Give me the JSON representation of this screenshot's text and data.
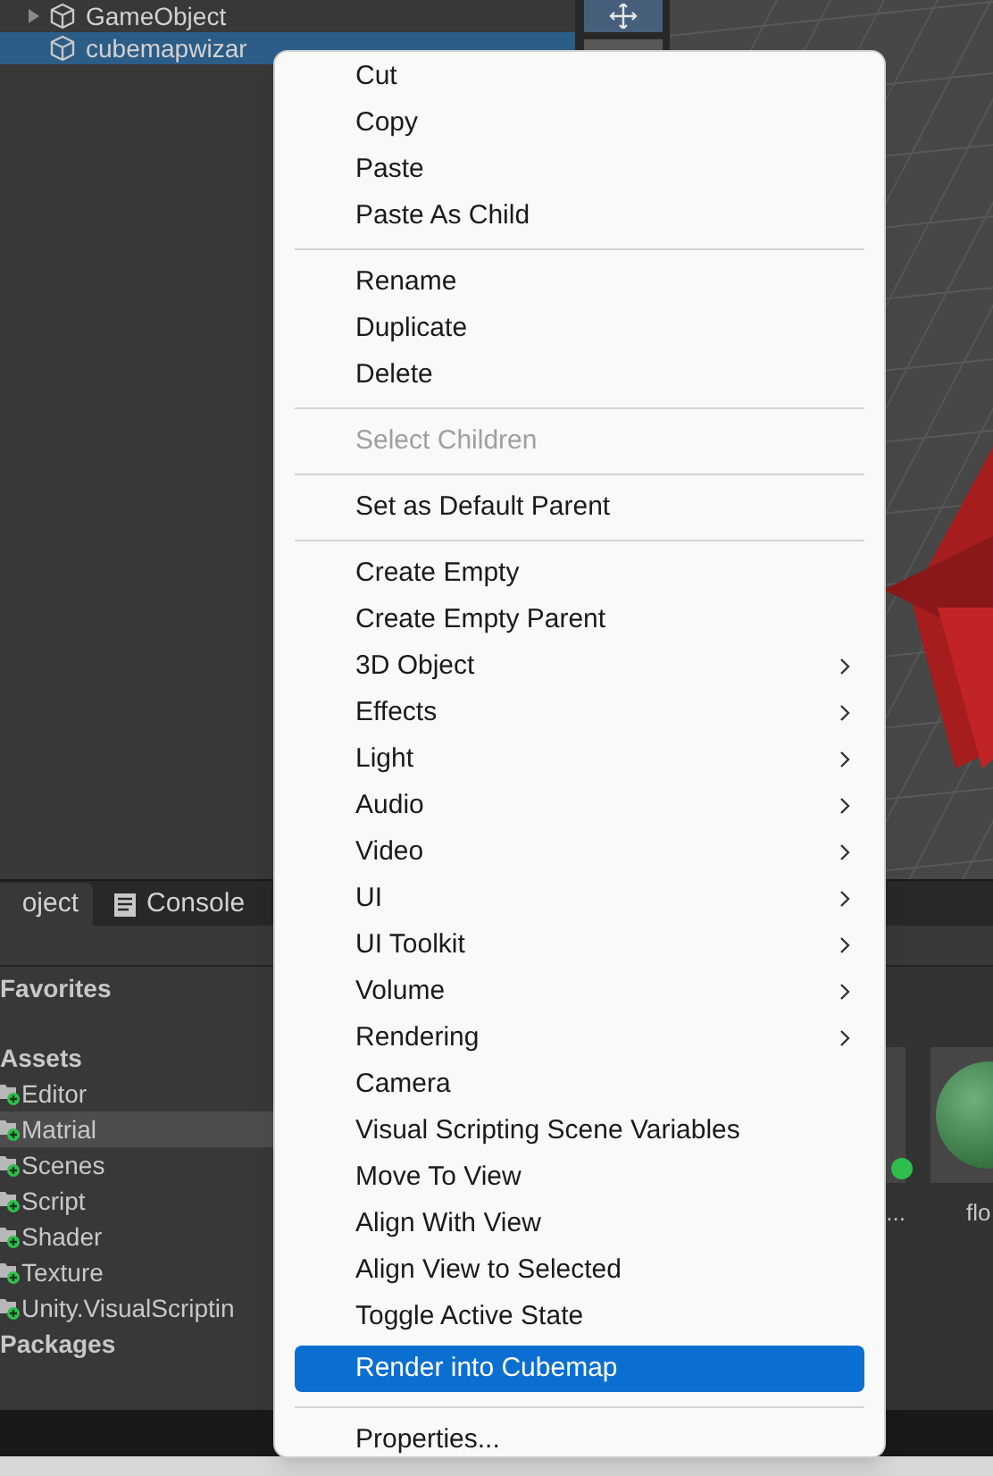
{
  "hierarchy": {
    "rows": [
      {
        "label": "GameObject",
        "selected": false,
        "expandable": true
      },
      {
        "label": "cubemapwizar",
        "selected": true,
        "expandable": false
      }
    ]
  },
  "bottom_panel": {
    "tabs": [
      {
        "label": "oject",
        "selected": true,
        "kind": "project"
      },
      {
        "label": "Console",
        "selected": false,
        "kind": "console"
      }
    ],
    "tree": [
      {
        "label": "Favorites",
        "kind": "header",
        "selected": false
      },
      {
        "label": "Assets",
        "kind": "header",
        "selected": false
      },
      {
        "label": "Editor",
        "kind": "folder",
        "selected": false
      },
      {
        "label": "Matrial",
        "kind": "folder",
        "selected": true
      },
      {
        "label": "Scenes",
        "kind": "folder",
        "selected": false
      },
      {
        "label": "Script",
        "kind": "folder",
        "selected": false
      },
      {
        "label": "Shader",
        "kind": "folder",
        "selected": false
      },
      {
        "label": "Texture",
        "kind": "folder",
        "selected": false
      },
      {
        "label": "Unity.VisualScriptin",
        "kind": "folder",
        "selected": false
      },
      {
        "label": "Packages",
        "kind": "header",
        "selected": false
      }
    ],
    "assets": [
      {
        "label": "...",
        "kind": "prefab"
      },
      {
        "label": "flo",
        "kind": "material"
      }
    ]
  },
  "context_menu": {
    "groups": [
      [
        {
          "label": "Cut",
          "disabled": false,
          "submenu": false,
          "selected": false
        },
        {
          "label": "Copy",
          "disabled": false,
          "submenu": false,
          "selected": false
        },
        {
          "label": "Paste",
          "disabled": false,
          "submenu": false,
          "selected": false
        },
        {
          "label": "Paste As Child",
          "disabled": false,
          "submenu": false,
          "selected": false
        }
      ],
      [
        {
          "label": "Rename",
          "disabled": false,
          "submenu": false,
          "selected": false
        },
        {
          "label": "Duplicate",
          "disabled": false,
          "submenu": false,
          "selected": false
        },
        {
          "label": "Delete",
          "disabled": false,
          "submenu": false,
          "selected": false
        }
      ],
      [
        {
          "label": "Select Children",
          "disabled": true,
          "submenu": false,
          "selected": false
        }
      ],
      [
        {
          "label": "Set as Default Parent",
          "disabled": false,
          "submenu": false,
          "selected": false
        }
      ],
      [
        {
          "label": "Create Empty",
          "disabled": false,
          "submenu": false,
          "selected": false
        },
        {
          "label": "Create Empty Parent",
          "disabled": false,
          "submenu": false,
          "selected": false
        },
        {
          "label": "3D Object",
          "disabled": false,
          "submenu": true,
          "selected": false
        },
        {
          "label": "Effects",
          "disabled": false,
          "submenu": true,
          "selected": false
        },
        {
          "label": "Light",
          "disabled": false,
          "submenu": true,
          "selected": false
        },
        {
          "label": "Audio",
          "disabled": false,
          "submenu": true,
          "selected": false
        },
        {
          "label": "Video",
          "disabled": false,
          "submenu": true,
          "selected": false
        },
        {
          "label": "UI",
          "disabled": false,
          "submenu": true,
          "selected": false
        },
        {
          "label": "UI Toolkit",
          "disabled": false,
          "submenu": true,
          "selected": false
        },
        {
          "label": "Volume",
          "disabled": false,
          "submenu": true,
          "selected": false
        },
        {
          "label": "Rendering",
          "disabled": false,
          "submenu": true,
          "selected": false
        },
        {
          "label": "Camera",
          "disabled": false,
          "submenu": false,
          "selected": false
        },
        {
          "label": "Visual Scripting Scene Variables",
          "disabled": false,
          "submenu": false,
          "selected": false
        },
        {
          "label": "Move To View",
          "disabled": false,
          "submenu": false,
          "selected": false
        },
        {
          "label": "Align With View",
          "disabled": false,
          "submenu": false,
          "selected": false
        },
        {
          "label": "Align View to Selected",
          "disabled": false,
          "submenu": false,
          "selected": false
        },
        {
          "label": "Toggle Active State",
          "disabled": false,
          "submenu": false,
          "selected": false
        },
        {
          "label": "Render into Cubemap",
          "disabled": false,
          "submenu": false,
          "selected": true
        }
      ],
      [
        {
          "label": "Properties...",
          "disabled": false,
          "submenu": false,
          "selected": false
        }
      ]
    ]
  }
}
